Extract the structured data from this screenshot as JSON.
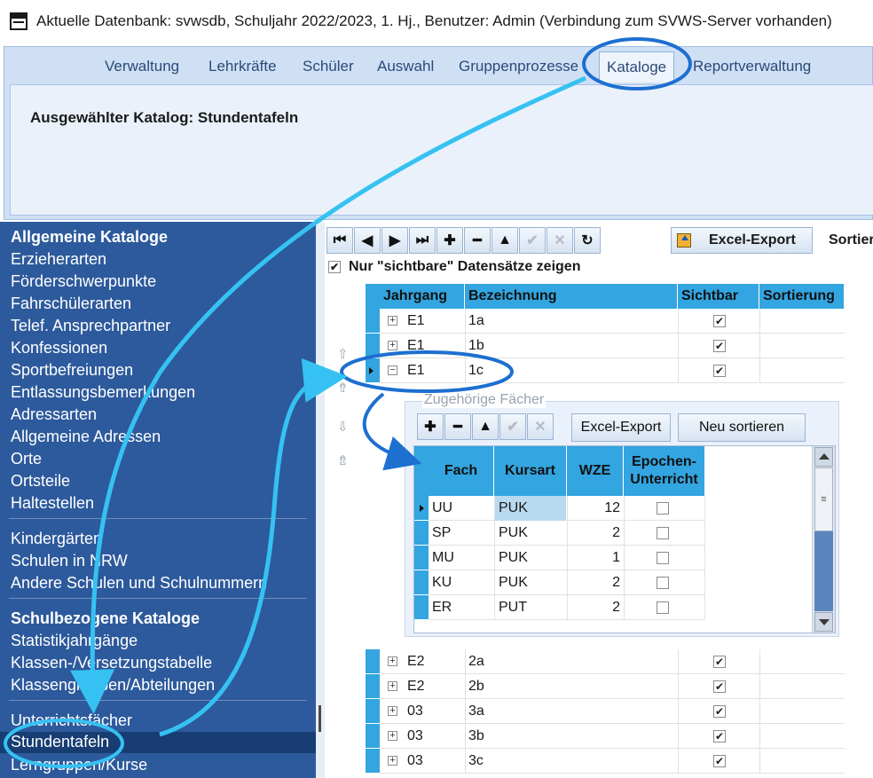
{
  "window": {
    "title": "Aktuelle Datenbank: svwsdb, Schuljahr 2022/2023, 1. Hj., Benutzer: Admin (Verbindung zum SVWS-Server vorhanden)"
  },
  "ribbon": {
    "tabs": [
      "Verwaltung",
      "Lehrkräfte",
      "Schüler",
      "Auswahl",
      "Gruppenprozesse",
      "Kataloge",
      "Reportverwaltung"
    ],
    "active_tab": "Kataloge",
    "heading": "Ausgewählter Katalog: Stundentafeln"
  },
  "sidebar": {
    "general_header": "Allgemeine Kataloge",
    "general": [
      "Erzieherarten",
      "Förderschwerpunkte",
      "Fahrschülerarten",
      "Telef. Ansprechpartner",
      "Konfessionen",
      "Sportbefreiungen",
      "Entlassungsbemerkungen",
      "Adressarten",
      "Allgemeine Adressen",
      "Orte",
      "Ortsteile",
      "Haltestellen"
    ],
    "external": [
      "Kindergärten",
      "Schulen in NRW",
      "Andere Schulen und Schulnummern"
    ],
    "school_header": "Schulbezogene Kataloge",
    "school": [
      "Statistikjahrgänge",
      "Klassen-/Versetzungstabelle",
      "Klassengruppen/Abteilungen"
    ],
    "subjects": [
      "Unterrichtsfächer",
      "Stundentafeln",
      "Lerngruppen/Kurse"
    ],
    "selected": "Stundentafeln"
  },
  "toolbar": {
    "buttons": [
      "first",
      "prev",
      "next",
      "last",
      "add",
      "remove",
      "up",
      "confirm",
      "cancel",
      "refresh"
    ],
    "excel_label": "Excel-Export",
    "sort_label": "Sortier",
    "visible_only_label": "Nur \"sichtbare\" Datensätze zeigen",
    "visible_only_checked": true
  },
  "grid": {
    "columns": [
      "Jahrgang",
      "Bezeichnung",
      "Sichtbar",
      "Sortierung"
    ],
    "rows_top": [
      {
        "jahrgang": "E1",
        "bezeichnung": "1a",
        "sichtbar": true,
        "expanded": false,
        "current": false
      },
      {
        "jahrgang": "E1",
        "bezeichnung": "1b",
        "sichtbar": true,
        "expanded": false,
        "current": false
      },
      {
        "jahrgang": "E1",
        "bezeichnung": "1c",
        "sichtbar": true,
        "expanded": true,
        "current": true
      }
    ],
    "rows_bottom": [
      {
        "jahrgang": "E2",
        "bezeichnung": "2a",
        "sichtbar": true
      },
      {
        "jahrgang": "E2",
        "bezeichnung": "2b",
        "sichtbar": true
      },
      {
        "jahrgang": "03",
        "bezeichnung": "3a",
        "sichtbar": true
      },
      {
        "jahrgang": "03",
        "bezeichnung": "3b",
        "sichtbar": true
      },
      {
        "jahrgang": "03",
        "bezeichnung": "3c",
        "sichtbar": true
      }
    ]
  },
  "detail": {
    "title": "Zugehörige Fächer",
    "excel_label": "Excel-Export",
    "resort_label": "Neu sortieren",
    "columns": [
      "Fach",
      "Kursart",
      "WZE",
      "Epochen-Unterricht"
    ],
    "columns_display": [
      "Fach",
      "Kursart",
      "WZE",
      "Epochen-\nUnterricht"
    ],
    "rows": [
      {
        "fach": "UU",
        "kursart": "PUK",
        "wze": "12",
        "epochen": false
      },
      {
        "fach": "SP",
        "kursart": "PUK",
        "wze": "2",
        "epochen": false
      },
      {
        "fach": "MU",
        "kursart": "PUK",
        "wze": "1",
        "epochen": false
      },
      {
        "fach": "KU",
        "kursart": "PUK",
        "wze": "2",
        "epochen": false
      },
      {
        "fach": "ER",
        "kursart": "PUT",
        "wze": "2",
        "epochen": false
      }
    ]
  },
  "colors": {
    "annotation": "#1c8fe0",
    "annotation_light": "#35c2f2",
    "grid_header": "#33a5e0",
    "sidebar": "#2d5a9c",
    "sidebar_selected": "#173d73"
  }
}
